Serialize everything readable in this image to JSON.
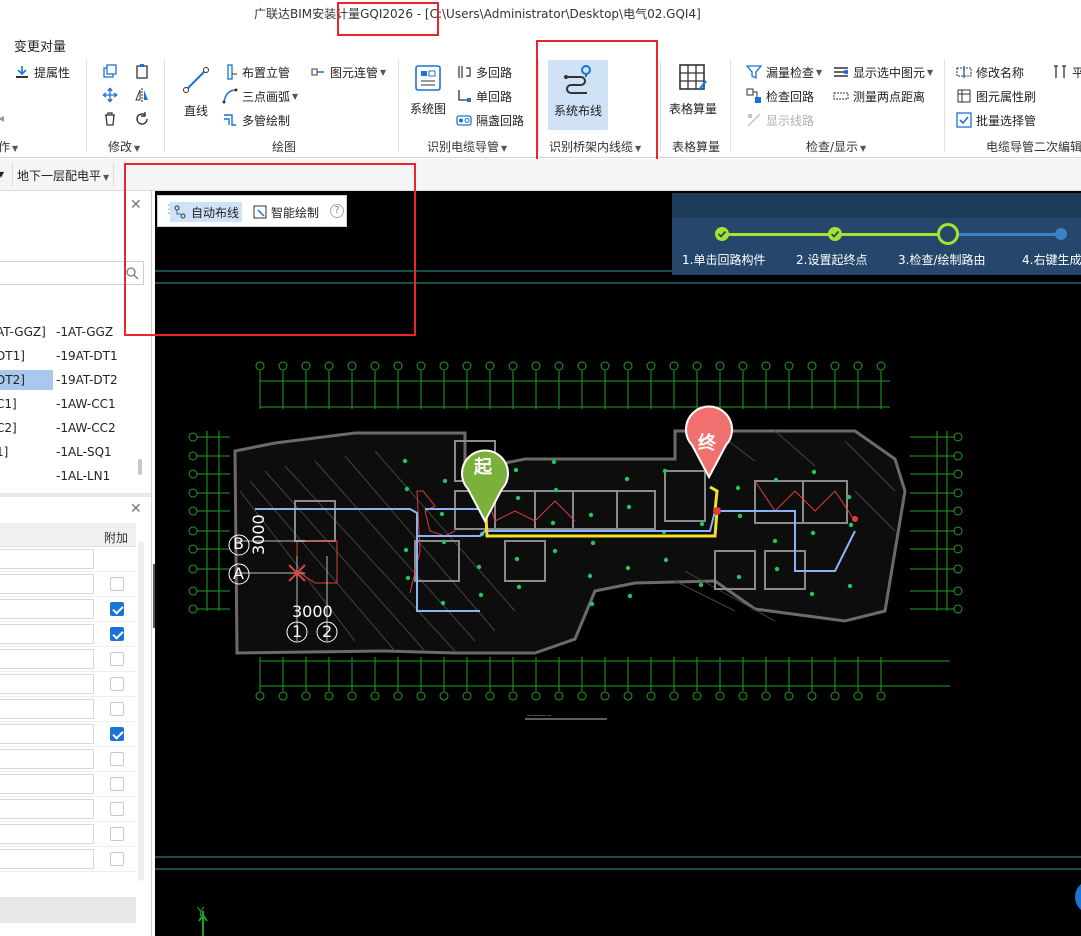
{
  "window": {
    "title": "广联达BIM安装计量GQI2026 - [C:\\Users\\Administrator\\Desktop\\电气02.GQI4]"
  },
  "menu": {
    "active": "变更对量"
  },
  "ribbon": {
    "group0": {
      "tip_item": "提属性",
      "label_partial": "作"
    },
    "modify": {
      "label": "修改"
    },
    "draw": {
      "label": "绘图",
      "line_label": "直线",
      "items": [
        "布置立管",
        "三点画弧",
        "多管绘制"
      ],
      "extra": "图元连管"
    },
    "cable_pipe": {
      "label": "识别电缆导管",
      "system_diagram": "系统图",
      "items": [
        "多回路",
        "单回路",
        "隔盏回路"
      ]
    },
    "tray_cable": {
      "label": "识别桥架内线缆",
      "system_routing": "系统布线"
    },
    "table": {
      "label": "表格算量",
      "button": "表格算量"
    },
    "check": {
      "label": "检查/显示",
      "items": [
        "漏量检查",
        "检查回路",
        "显示线路"
      ],
      "items2": [
        "显示选中图元",
        "测量两点距离"
      ]
    },
    "secondary_edit": {
      "label": "电缆导管二次编辑",
      "items": [
        "修改名称",
        "图元属性刷",
        "批量选择管"
      ],
      "cut": "平"
    },
    "colors": {
      "accent": "#1a73d6",
      "highlight": "#cfe2f6",
      "annotation": "#e8262b"
    }
  },
  "subbar": {
    "dropdown": "地下一层配电平"
  },
  "left_panel": {
    "rows": [
      {
        "a": "AT-GGZ]",
        "b": "-1AT-GGZ",
        "selected": false
      },
      {
        "a": "DT1]",
        "b": "-19AT-DT1",
        "selected": false
      },
      {
        "a": "DT2]",
        "b": "-19AT-DT2",
        "selected": true
      },
      {
        "a": "C1]",
        "b": "-1AW-CC1",
        "selected": false
      },
      {
        "a": "C2]",
        "b": "-1AW-CC2",
        "selected": false
      },
      {
        "a": "1]",
        "b": "-1AL-SQ1",
        "selected": false
      },
      {
        "a": "]",
        "b": "-1AL-LN1",
        "selected": false
      }
    ],
    "props": {
      "extra_header": "附加",
      "checks": [
        null,
        false,
        true,
        true,
        false,
        false,
        false,
        true,
        false,
        false,
        false,
        false,
        false
      ]
    }
  },
  "float_toolbar": {
    "auto_routing": "自动布线",
    "smart_draw": "智能绘制",
    "help": "?"
  },
  "stepper": {
    "steps": [
      {
        "label": "1.单击回路构件",
        "state": "done"
      },
      {
        "label": "2.设置起终点",
        "state": "done"
      },
      {
        "label": "3.检查/绘制路由",
        "state": "current"
      },
      {
        "label": "4.右键生成",
        "state": "pending"
      }
    ],
    "colors": {
      "done": "#a6e22e",
      "pending": "#3b82c4",
      "bg": "#26476b"
    }
  },
  "canvas": {
    "start_marker": "起",
    "end_marker": "终",
    "axis_labels": {
      "b": "B",
      "a": "A",
      "one": "1",
      "two": "2"
    },
    "dims": {
      "vertical": "3000",
      "horizontal": "3000"
    },
    "y_axis": "Y"
  }
}
